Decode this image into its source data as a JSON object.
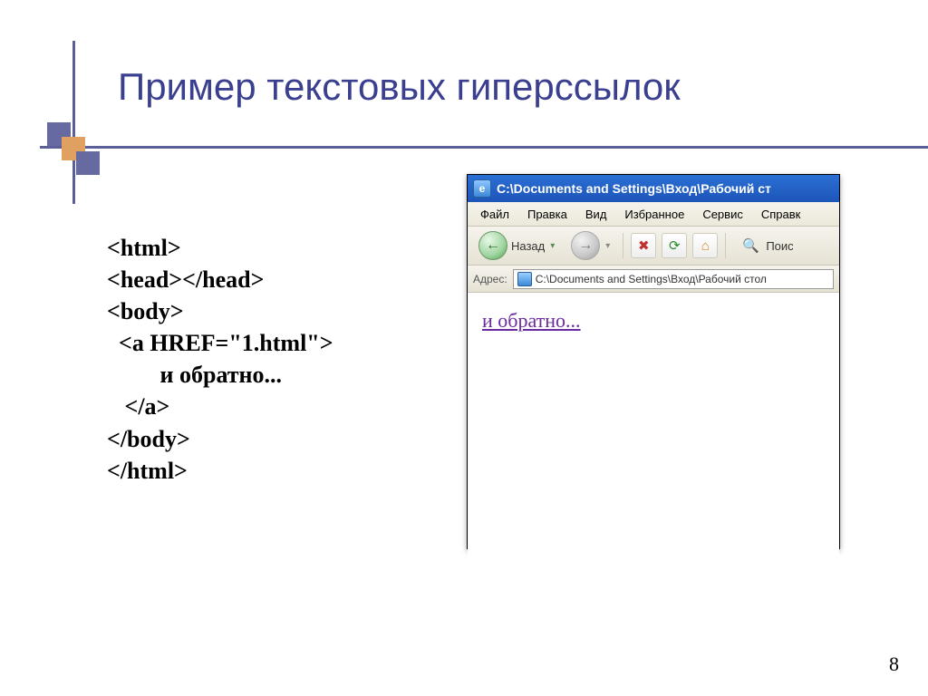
{
  "slide": {
    "title": "Пример текстовых гиперссылок",
    "page_number": "8"
  },
  "code": {
    "l1": "<html>",
    "l2": "<head></head>",
    "l3": "<body>",
    "l4": "  <a HREF=\"1.html\">",
    "l5": "         и обратно...",
    "l6": "   </a>",
    "l7": "</body>",
    "l8": "</html>"
  },
  "browser": {
    "title": "C:\\Documents and Settings\\Вход\\Рабочий ст",
    "menus": {
      "file": "Файл",
      "edit": "Правка",
      "view": "Вид",
      "favorites": "Избранное",
      "tools": "Сервис",
      "help": "Справк"
    },
    "toolbar": {
      "back": "Назад",
      "search": "Поис"
    },
    "address": {
      "label": "Адрес:",
      "value": "C:\\Documents and Settings\\Вход\\Рабочий стол"
    },
    "page": {
      "link_text": "и обратно..."
    }
  }
}
